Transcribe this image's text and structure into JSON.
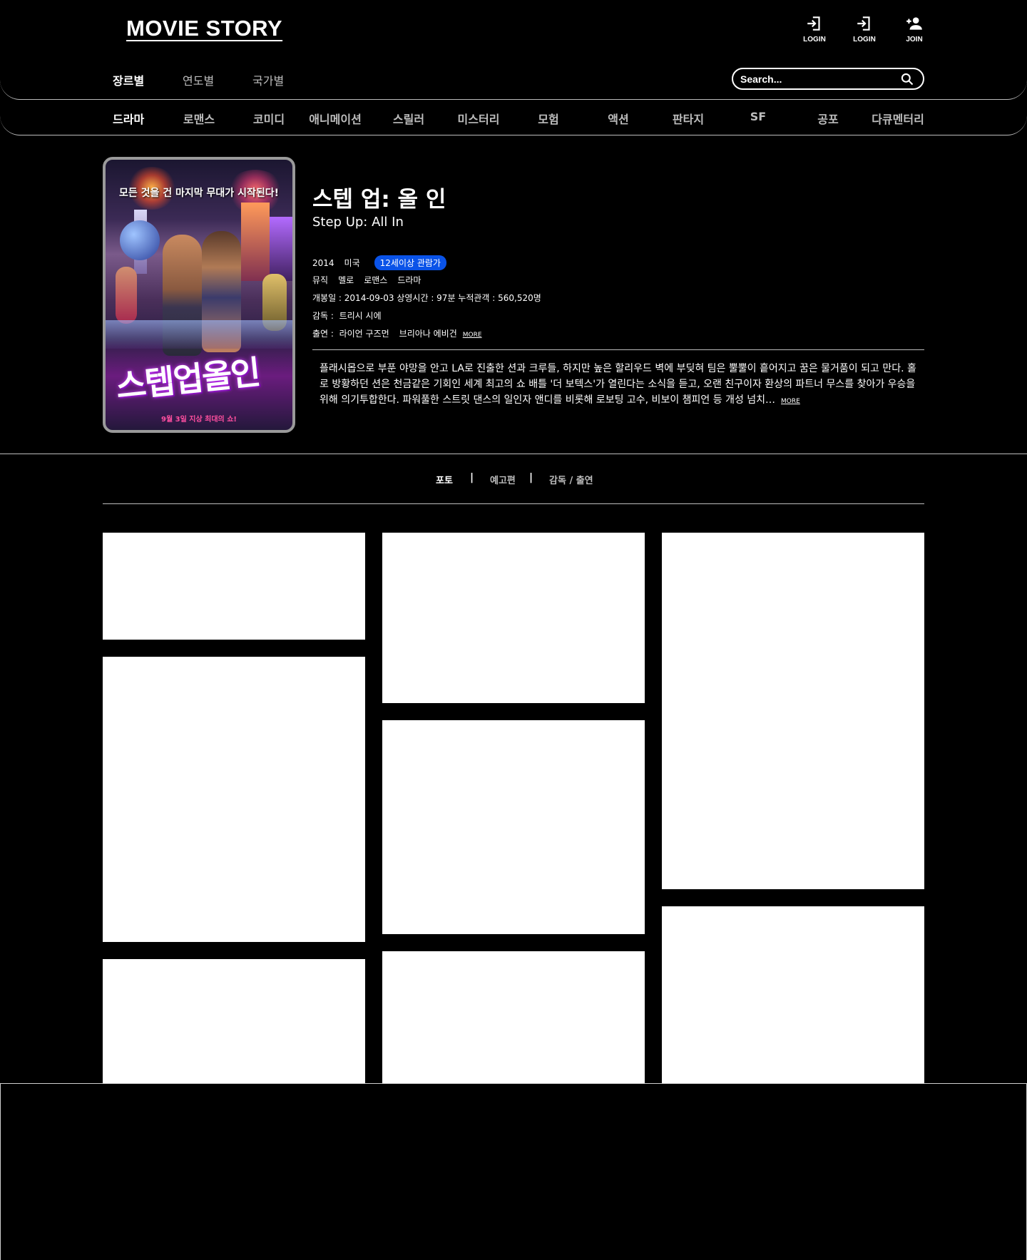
{
  "header": {
    "logo": "MOVIE STORY",
    "auth": [
      {
        "label": "LOGIN",
        "icon": "login-icon"
      },
      {
        "label": "LOGIN",
        "icon": "login-icon"
      },
      {
        "label": "JOIN",
        "icon": "person-add-icon"
      }
    ],
    "nav": [
      "장르별",
      "연도별",
      "국가별"
    ],
    "search": {
      "placeholder": "Search...",
      "icon": "search-icon"
    }
  },
  "genres": [
    "드라마",
    "로맨스",
    "코미디",
    "애니메이션",
    "스릴러",
    "미스터리",
    "모험",
    "액션",
    "판타지",
    "SF",
    "공포",
    "다큐멘터리"
  ],
  "movie": {
    "poster": {
      "tagline": "모든 것을 건 마지막 무대가 시작된다!",
      "title": "스텝업올인",
      "release_note": "9월 3일 지상 최대의 쇼!"
    },
    "title_ko": "스텝 업: 올 인",
    "title_en": "Step Up: All In",
    "year": "2014",
    "country": "미국",
    "rating": "12세이상 관람가",
    "genres": [
      "뮤직",
      "멜로",
      "로맨스",
      "드라마"
    ],
    "release_line": "개봉일 : 2014-09-03  상영시간 : 97분  누적관객 : 560,520명",
    "director_label": "감독 :",
    "director": "트리시 시에",
    "cast_label": "출연 :",
    "cast": [
      "라이언 구즈먼",
      "브리아나 에비건"
    ],
    "more_label": "MORE",
    "synopsis": "플래시몹으로 부푼 야망을 안고 LA로 진출한 션과 크루들, 하지만 높은 할리우드 벽에 부딪혀 팀은 뿔뿔이 흩어지고 꿈은 물거품이 되고 만다. 홀로 방황하던 션은 천금같은 기회인 세계 최고의 쇼 배틀 '더 보텍스'가 열린다는 소식을 듣고, 오랜 친구이자 환상의 파트너 무스를 찾아가 우승을 위해 의기투합한다. 파워풀한 스트릿 댄스의 일인자 앤디를 비롯해 로보팅 고수, 비보이 챔피언 등 개성 넘치…"
  },
  "tabs": [
    "포토",
    "예고편",
    "감독 / 출연"
  ],
  "tab_separator": "|",
  "colors": {
    "background": "#000000",
    "rating_badge": "#0A53E8",
    "divider": "#BDBDBD"
  }
}
